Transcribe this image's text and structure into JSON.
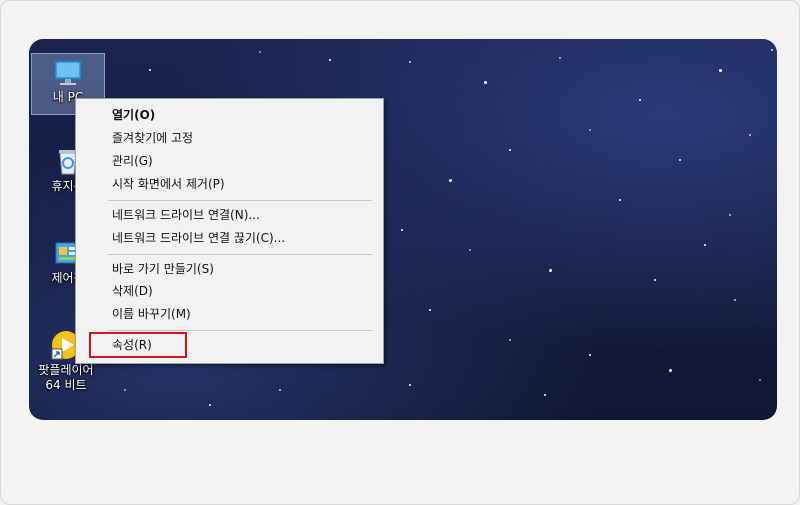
{
  "desktop": {
    "icons": [
      {
        "label": "내 PC",
        "icon": "computer-icon"
      },
      {
        "label": "휴지통",
        "icon": "recycle-bin-icon"
      },
      {
        "label": "제어판",
        "icon": "control-panel-icon"
      },
      {
        "label": "팟플레이어 64 비트",
        "label_line1": "팟플레이어",
        "label_line2": "64 비트",
        "icon": "potplayer-icon"
      }
    ]
  },
  "context_menu": {
    "items": [
      {
        "label": "열기(O)",
        "bold": true
      },
      {
        "label": "즐겨찾기에 고정"
      },
      {
        "label": "관리(G)"
      },
      {
        "label": "시작 화면에서 제거(P)"
      },
      {
        "label": "네트워크 드라이브 연결(N)..."
      },
      {
        "label": "네트워크 드라이브 연결 끊기(C)..."
      },
      {
        "label": "바로 가기 만들기(S)"
      },
      {
        "label": "삭제(D)"
      },
      {
        "label": "이름 바꾸기(M)"
      },
      {
        "label": "속성(R)",
        "highlighted": true
      }
    ]
  },
  "colors": {
    "highlight": "#d9141e",
    "menu_bg": "#f2f2f2",
    "desktop_bg": "#141b3d"
  }
}
